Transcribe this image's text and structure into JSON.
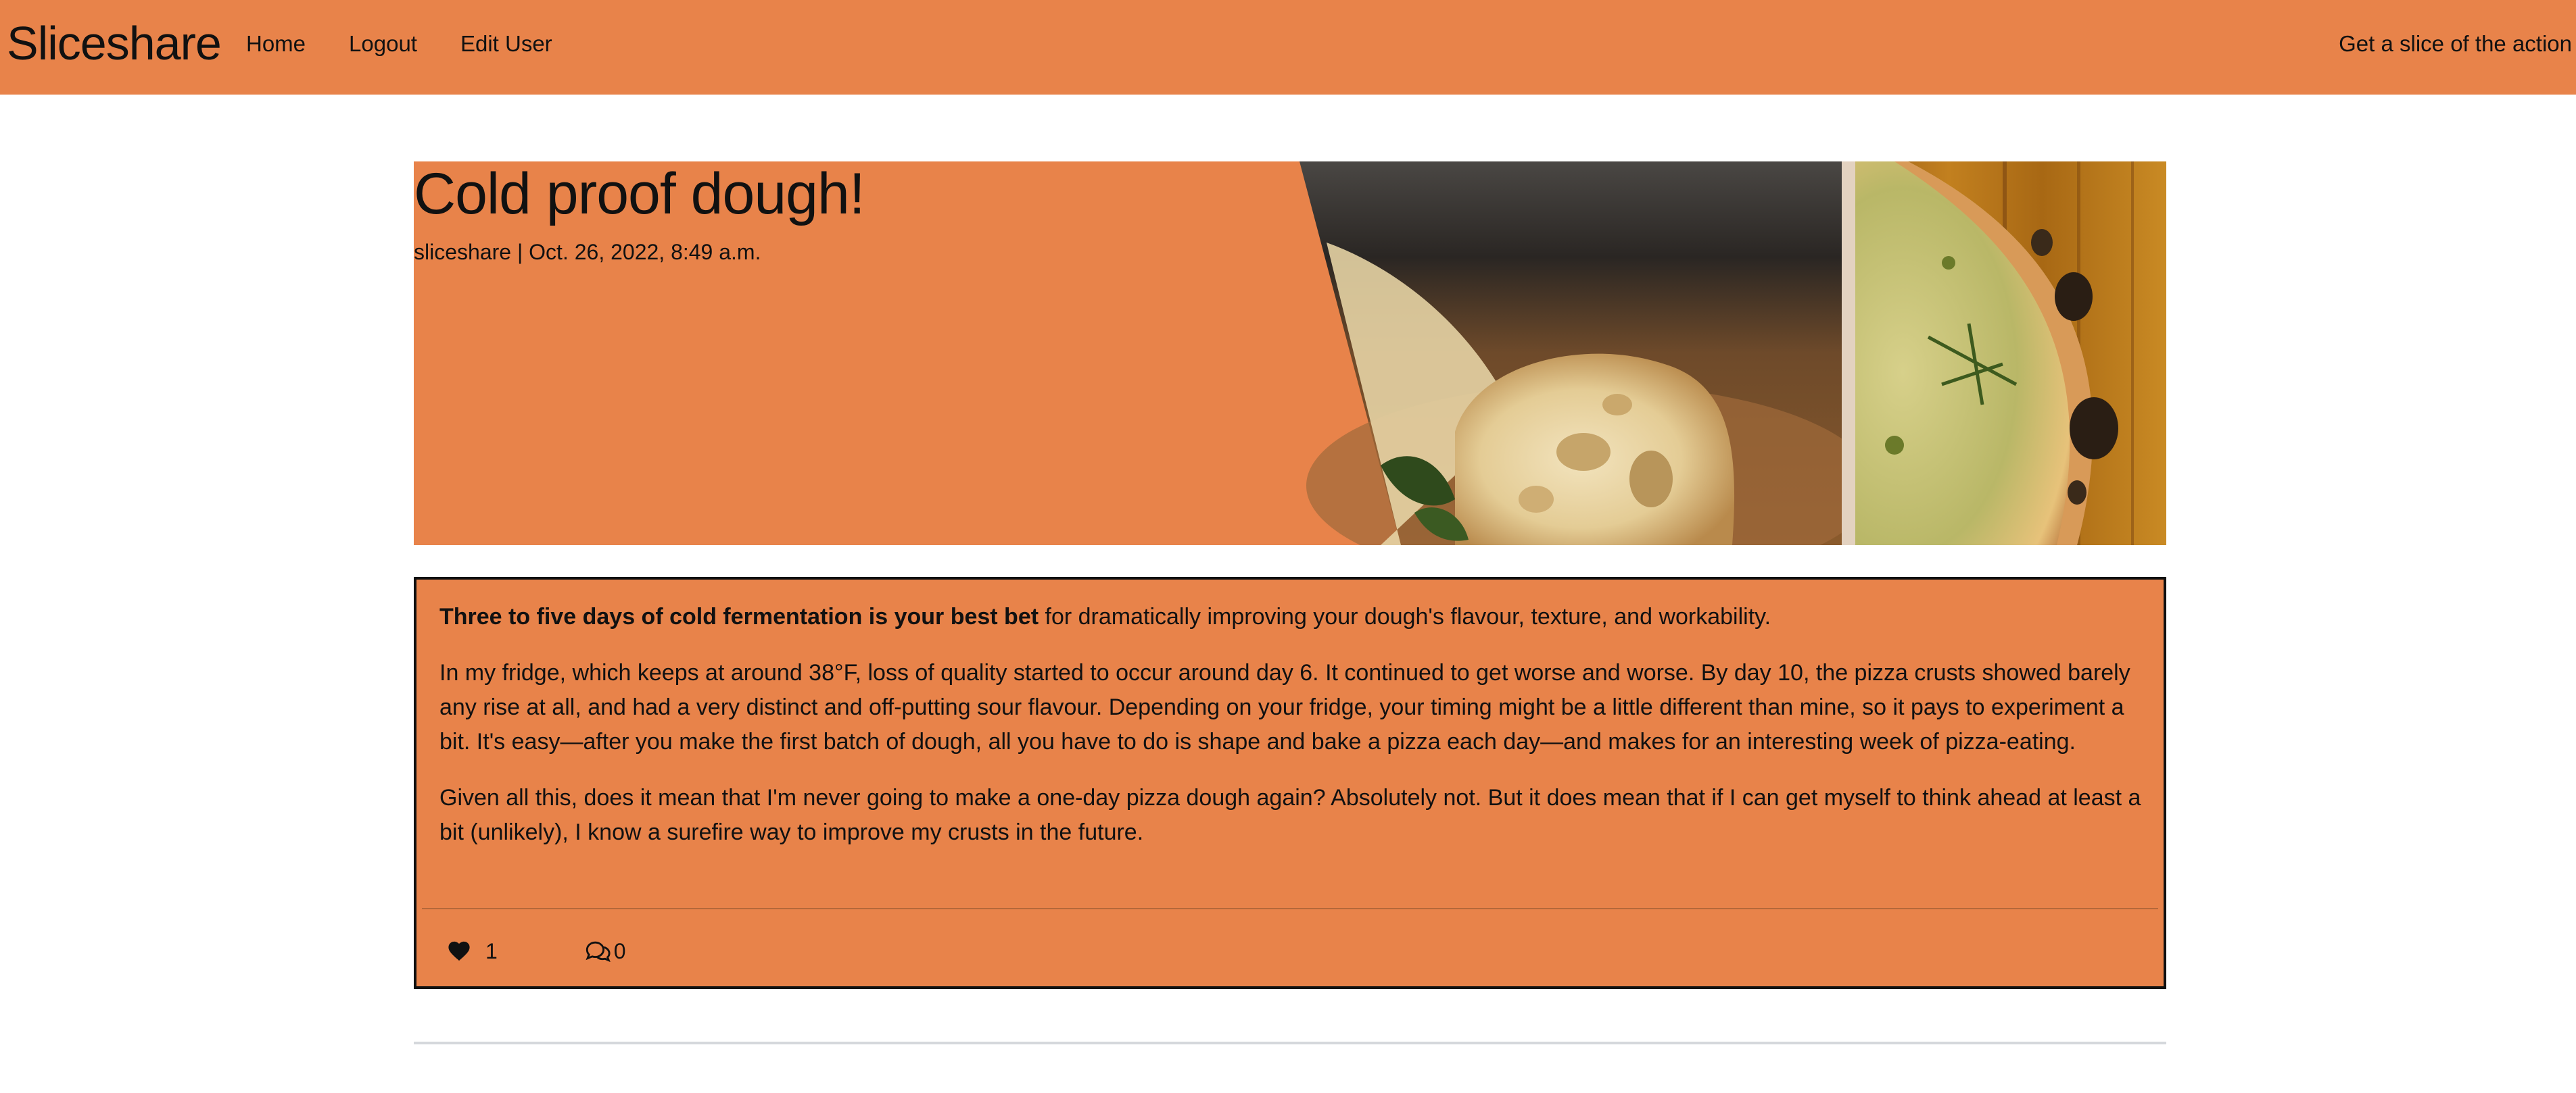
{
  "navbar": {
    "brand": "Sliceshare",
    "links": [
      "Home",
      "Logout",
      "Edit User"
    ],
    "tagline": "Get a slice of the action",
    "color": "#E8834A"
  },
  "post": {
    "title": "Cold proof dough!",
    "meta": "sliceshare | Oct. 26, 2022, 8:49 a.m.",
    "body": {
      "lead_bold": "Three to five days of cold fermentation is your best bet",
      "lead_rest": " for dramatically improving your dough's flavour, texture, and workability.",
      "paragraph_2": "In my fridge, which keeps at around 38°F, loss of quality started to occur around day 6. It continued to get worse and worse. By day 10, the pizza crusts showed barely any rise at all, and had a very distinct and off-putting sour flavour. Depending on your fridge, your timing might be a little different than mine, so it pays to experiment a bit. It's easy—after you make the first batch of dough, all you have to do is shape and bake a pizza each day—and makes for an interesting week of pizza-eating.",
      "paragraph_3": "Given all this, does it mean that I'm never going to make a one-day pizza dough again? Absolutely not. But it does mean that if I can get myself to think ahead at least a bit (unlikely), I know a surefire way to improve my crusts in the future."
    },
    "likes": "1",
    "comments": "0",
    "icons": {
      "like": "heart-icon",
      "comment": "comments-icon"
    }
  }
}
